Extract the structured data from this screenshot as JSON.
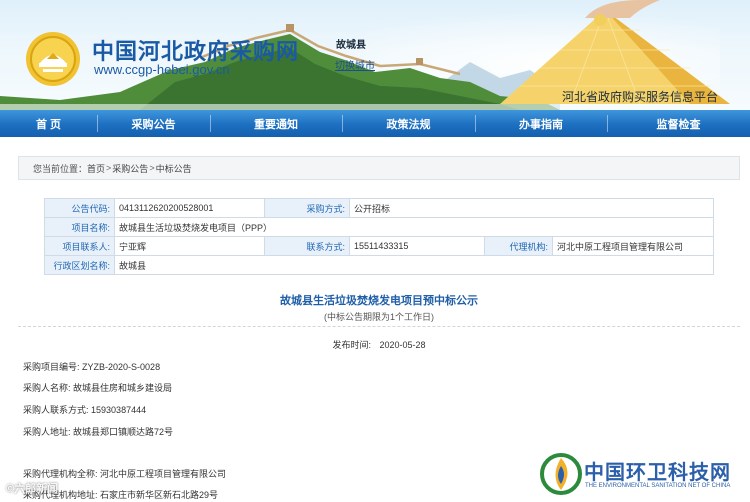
{
  "header": {
    "site_title": "中国河北政府采购网",
    "site_url": "www.ccgp-hebei.gov.cn",
    "county": "故城县",
    "switch_city": "切换城市",
    "platform": "河北省政府购买服务信息平台"
  },
  "nav": [
    {
      "label": "首 页"
    },
    {
      "label": "采购公告"
    },
    {
      "label": "重要通知"
    },
    {
      "label": "政策法规"
    },
    {
      "label": "办事指南"
    },
    {
      "label": "监督检查"
    }
  ],
  "breadcrumb": {
    "prefix": "您当前位置：",
    "items": [
      "首页",
      "采购公告",
      "中标公告"
    ]
  },
  "info": {
    "notice_code_label": "公告代码:",
    "notice_code": "0413112620200528001",
    "purchase_method_label": "采购方式:",
    "purchase_method": "公开招标",
    "project_name_label": "项目名称:",
    "project_name": "故城县生活垃圾焚烧发电项目（PPP）",
    "contact_label": "项目联系人:",
    "contact": "宁亚辉",
    "phone_label": "联系方式:",
    "phone": "15511433315",
    "agency_label": "代理机构:",
    "agency": "河北中原工程项目管理有限公司",
    "region_label": "行政区划名称:",
    "region": "故城县"
  },
  "notice": {
    "title": "故城县生活垃圾焚烧发电项目预中标公示",
    "subtitle": "(中标公告期限为1个工作日)",
    "publish_label": "发布时间:",
    "publish_date": "2020-05-28"
  },
  "details": [
    {
      "label": "采购项目编号:",
      "value": "ZYZB-2020-S-0028"
    },
    {
      "label": "采购人名称:",
      "value": "故城县住房和城乡建设局"
    },
    {
      "label": "采购人联系方式:",
      "value": "15930387444"
    },
    {
      "label": "采购人地址:",
      "value": "故城县郑口镇顺达路72号"
    },
    {
      "label": "采购代理机构全称:",
      "value": "河北中原工程项目管理有限公司"
    },
    {
      "label": "采购代理机构地址:",
      "value": "石家庄市新华区新石北路29号"
    }
  ],
  "watermarks": {
    "left": "©六郎新闻",
    "right_title": "中国环卫科技网",
    "right_sub": "THE ENVIRONMENTAL SANITATION NET OF CHINA"
  },
  "colors": {
    "brand_blue": "#1a5aa5",
    "nav_blue": "#1d6fc0",
    "label_bg": "#e8f1fa",
    "link_blue": "#1f66b3"
  }
}
